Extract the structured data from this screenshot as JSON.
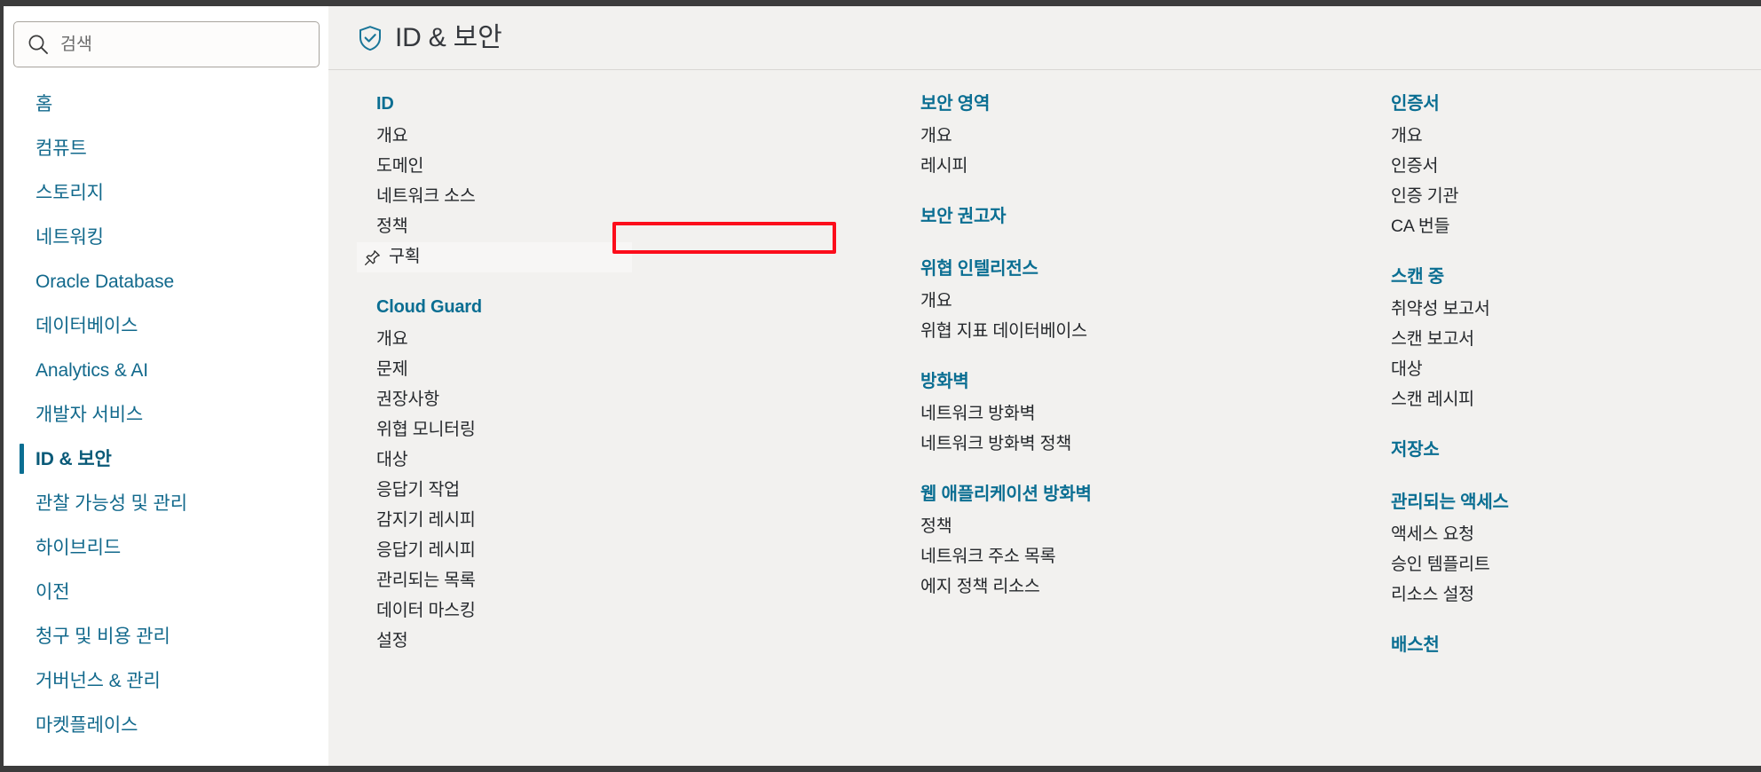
{
  "search": {
    "placeholder": "검색",
    "value": "",
    "icon": "search-icon"
  },
  "sidebar": {
    "items": [
      {
        "label": "홈",
        "active": false
      },
      {
        "label": "컴퓨트",
        "active": false
      },
      {
        "label": "스토리지",
        "active": false
      },
      {
        "label": "네트워킹",
        "active": false
      },
      {
        "label": "Oracle Database",
        "active": false
      },
      {
        "label": "데이터베이스",
        "active": false
      },
      {
        "label": "Analytics & AI",
        "active": false
      },
      {
        "label": "개발자 서비스",
        "active": false
      },
      {
        "label": "ID & 보안",
        "active": true
      },
      {
        "label": "관찰 가능성 및 관리",
        "active": false
      },
      {
        "label": "하이브리드",
        "active": false
      },
      {
        "label": "이전",
        "active": false
      },
      {
        "label": "청구 및 비용 관리",
        "active": false
      },
      {
        "label": "거버넌스 & 관리",
        "active": false
      },
      {
        "label": "마켓플레이스",
        "active": false
      }
    ]
  },
  "header": {
    "title": "ID & 보안",
    "icon": "shield-check-icon"
  },
  "columns": [
    {
      "groups": [
        {
          "title": "ID",
          "links": [
            {
              "label": "개요"
            },
            {
              "label": "도메인"
            },
            {
              "label": "네트워크 소스"
            },
            {
              "label": "정책"
            },
            {
              "label": "구획",
              "pinned": true,
              "icon": "pin-icon"
            }
          ]
        },
        {
          "title": "Cloud Guard",
          "links": [
            {
              "label": "개요"
            },
            {
              "label": "문제"
            },
            {
              "label": "권장사항"
            },
            {
              "label": "위협 모니터링"
            },
            {
              "label": "대상"
            },
            {
              "label": "응답기 작업"
            },
            {
              "label": "감지기 레시피"
            },
            {
              "label": "응답기 레시피"
            },
            {
              "label": "관리되는 목록"
            },
            {
              "label": "데이터 마스킹"
            },
            {
              "label": "설정"
            }
          ]
        }
      ]
    },
    {
      "groups": [
        {
          "title": "보안 영역",
          "links": [
            {
              "label": "개요"
            },
            {
              "label": "레시피"
            }
          ]
        },
        {
          "title": "보안 권고자",
          "links": []
        },
        {
          "title": "위협 인텔리전스",
          "links": [
            {
              "label": "개요"
            },
            {
              "label": "위협 지표 데이터베이스"
            }
          ]
        },
        {
          "title": "방화벽",
          "links": [
            {
              "label": "네트워크 방화벽"
            },
            {
              "label": "네트워크 방화벽 정책"
            }
          ]
        },
        {
          "title": "웹 애플리케이션 방화벽",
          "links": [
            {
              "label": "정책"
            },
            {
              "label": "네트워크 주소 목록"
            },
            {
              "label": "에지 정책 리소스"
            }
          ]
        }
      ]
    },
    {
      "groups": [
        {
          "title": "인증서",
          "links": [
            {
              "label": "개요"
            },
            {
              "label": "인증서"
            },
            {
              "label": "인증 기관"
            },
            {
              "label": "CA 번들"
            }
          ]
        },
        {
          "title": "스캔 중",
          "links": [
            {
              "label": "취약성 보고서"
            },
            {
              "label": "스캔 보고서"
            },
            {
              "label": "대상"
            },
            {
              "label": "스캔 레시피"
            }
          ]
        },
        {
          "title": "저장소",
          "links": []
        },
        {
          "title": "관리되는 액세스",
          "links": [
            {
              "label": "액세스 요청"
            },
            {
              "label": "승인 템플리트"
            },
            {
              "label": "리소스 설정"
            }
          ]
        },
        {
          "title": "배스천",
          "links": []
        }
      ]
    }
  ],
  "annotation": {
    "type": "red-highlight-box",
    "target": "구획"
  },
  "colors": {
    "link_blue": "#12698c",
    "group_blue": "#0a6e92",
    "panel_bg": "#f2f1ef",
    "text": "#26292d",
    "highlight": "#fc0d1b"
  }
}
